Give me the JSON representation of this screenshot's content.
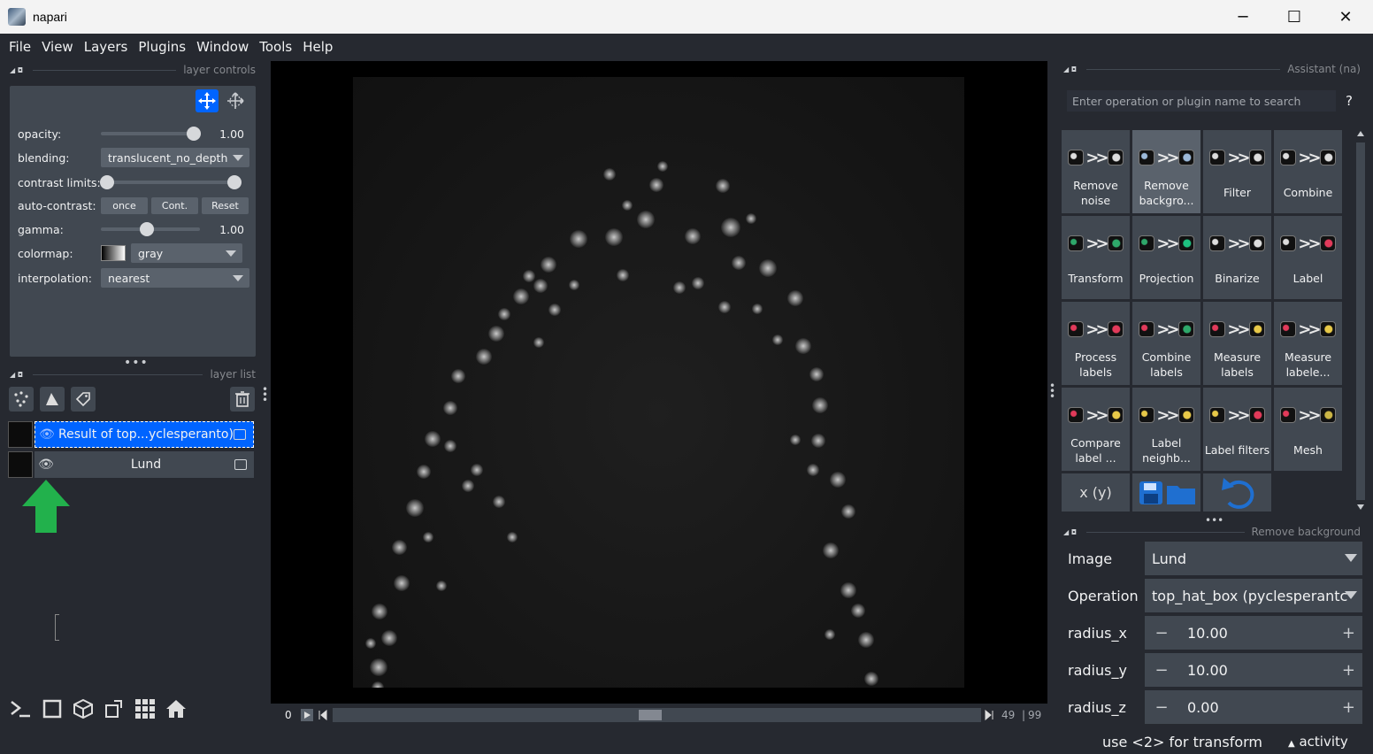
{
  "window": {
    "title": "napari",
    "minimize": "─",
    "maximize": "☐",
    "close": "✕"
  },
  "menu": [
    "File",
    "View",
    "Layers",
    "Plugins",
    "Window",
    "Tools",
    "Help"
  ],
  "layer_controls": {
    "title": "layer controls",
    "opacity_label": "opacity:",
    "opacity_value": "1.00",
    "opacity_level": 1.0,
    "blending_label": "blending:",
    "blending_value": "translucent_no_depth",
    "contrast_label": "contrast limits:",
    "autocontrast_label": "auto-contrast:",
    "once": "once",
    "cont": "Cont.",
    "reset": "Reset",
    "gamma_label": "gamma:",
    "gamma_value": "1.00",
    "colormap_label": "colormap:",
    "colormap_value": "gray",
    "interpolation_label": "interpolation:",
    "interpolation_value": "nearest"
  },
  "layer_list": {
    "title": "layer list",
    "layers": [
      {
        "name": "Result of top...yclesperanto)",
        "selected": true
      },
      {
        "name": "Lund",
        "selected": false
      }
    ]
  },
  "dims": {
    "start": "0",
    "current": "49",
    "total": "99",
    "position": 0.49
  },
  "assistant": {
    "title": "Assistant (na)",
    "search_placeholder": "Enter operation or plugin name to search",
    "help": "?",
    "tiles": [
      "Remove\nnoise",
      "Remove\nbackgro...",
      "Filter",
      "Combine",
      "Transform",
      "Projection",
      "Binarize",
      "Label",
      "Process\nlabels",
      "Combine\nlabels",
      "Measure\nlabels",
      "Measure\nlabele...",
      "Compare\nlabel ...",
      "Label\nneighb...",
      "Label filters",
      "Mesh"
    ],
    "code_label": "x (y)"
  },
  "remove_background": {
    "title": "Remove background",
    "image_label": "Image",
    "image_value": "Lund",
    "operation_label": "Operation",
    "operation_value": "top_hat_box (pyclesperantc",
    "radius_x_label": "radius_x",
    "radius_x_value": "10.00",
    "radius_y_label": "radius_y",
    "radius_y_value": "10.00",
    "radius_z_label": "radius_z",
    "radius_z_value": "0.00",
    "minus": "−",
    "plus": "+"
  },
  "status": {
    "hint": "use <2> for transform",
    "activity": "activity"
  },
  "colors": {
    "bg": "#262930",
    "panel": "#414851",
    "accent": "#5a626c",
    "selected": "#0064ff",
    "arrow": "#22b14c"
  }
}
